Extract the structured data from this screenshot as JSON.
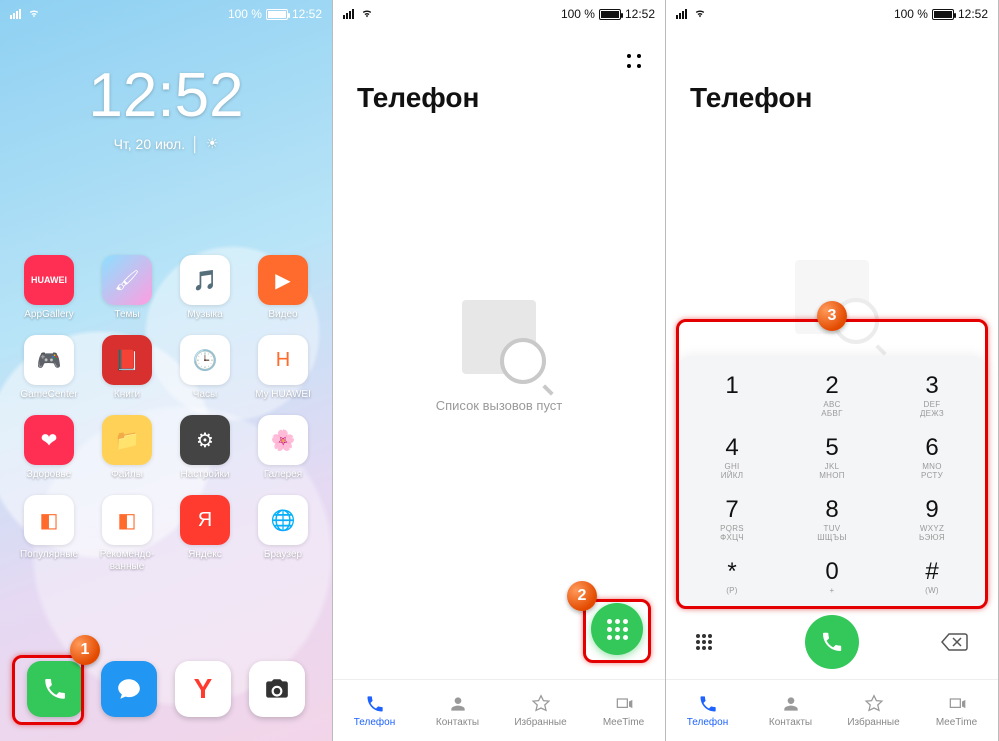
{
  "status": {
    "battery_pct": "100 %",
    "time": "12:52"
  },
  "home": {
    "clock_time": "12:52",
    "clock_date": "Чт, 20 июл.",
    "apps": [
      {
        "label": "AppGallery",
        "color": "#ff2f54",
        "glyph": "HUAWEI"
      },
      {
        "label": "Темы",
        "color": "linear-gradient(135deg,#8de0ff,#ff9de0)",
        "glyph": "🖌"
      },
      {
        "label": "Музыка",
        "color": "#ffffff",
        "glyph": "🎵"
      },
      {
        "label": "Видео",
        "color": "#ff6b2d",
        "glyph": "▶"
      },
      {
        "label": "GameCenter",
        "color": "#ffffff",
        "glyph": "🎮"
      },
      {
        "label": "Книги",
        "color": "#d7302e",
        "glyph": "📕"
      },
      {
        "label": "Часы",
        "color": "#ffffff",
        "glyph": "🕒"
      },
      {
        "label": "My HUAWEI",
        "color": "#ffffff",
        "glyph": "H"
      },
      {
        "label": "Здоровье",
        "color": "#ff2f54",
        "glyph": "❤"
      },
      {
        "label": "Файлы",
        "color": "#ffd257",
        "glyph": "📁"
      },
      {
        "label": "Настройки",
        "color": "#444",
        "glyph": "⚙"
      },
      {
        "label": "Галерея",
        "color": "#ffffff",
        "glyph": "🌸"
      },
      {
        "label": "Популярные",
        "color": "#ffffff",
        "glyph": "◧"
      },
      {
        "label": "Рекомендо-\nванные",
        "color": "#ffffff",
        "glyph": "◧"
      },
      {
        "label": "Яндекс",
        "color": "#ff3b30",
        "glyph": "Я"
      },
      {
        "label": "Браузер",
        "color": "#ffffff",
        "glyph": "🌐"
      }
    ]
  },
  "phone": {
    "title": "Телефон",
    "empty_text": "Список вызовов пуст",
    "nav": [
      {
        "label": "Телефон",
        "icon": "phone",
        "active": true
      },
      {
        "label": "Контакты",
        "icon": "contacts",
        "active": false
      },
      {
        "label": "Избранные",
        "icon": "star",
        "active": false
      },
      {
        "label": "MeeTime",
        "icon": "meetime",
        "active": false
      }
    ],
    "keypad": [
      {
        "num": "1",
        "sub": "",
        "sub2": ""
      },
      {
        "num": "2",
        "sub": "ABC",
        "sub2": "АБВГ"
      },
      {
        "num": "3",
        "sub": "DEF",
        "sub2": "ДЕЖЗ"
      },
      {
        "num": "4",
        "sub": "GHI",
        "sub2": "ИЙКЛ"
      },
      {
        "num": "5",
        "sub": "JKL",
        "sub2": "МНОП"
      },
      {
        "num": "6",
        "sub": "MNO",
        "sub2": "РСТУ"
      },
      {
        "num": "7",
        "sub": "PQRS",
        "sub2": "ФХЦЧ"
      },
      {
        "num": "8",
        "sub": "TUV",
        "sub2": "ШЩЪЫ"
      },
      {
        "num": "9",
        "sub": "WXYZ",
        "sub2": "ЬЭЮЯ"
      },
      {
        "num": "*",
        "sub": "(P)",
        "sub2": ""
      },
      {
        "num": "0",
        "sub": "+",
        "sub2": ""
      },
      {
        "num": "#",
        "sub": "(W)",
        "sub2": ""
      }
    ]
  },
  "annotations": {
    "step1": "1",
    "step2": "2",
    "step3": "3"
  }
}
